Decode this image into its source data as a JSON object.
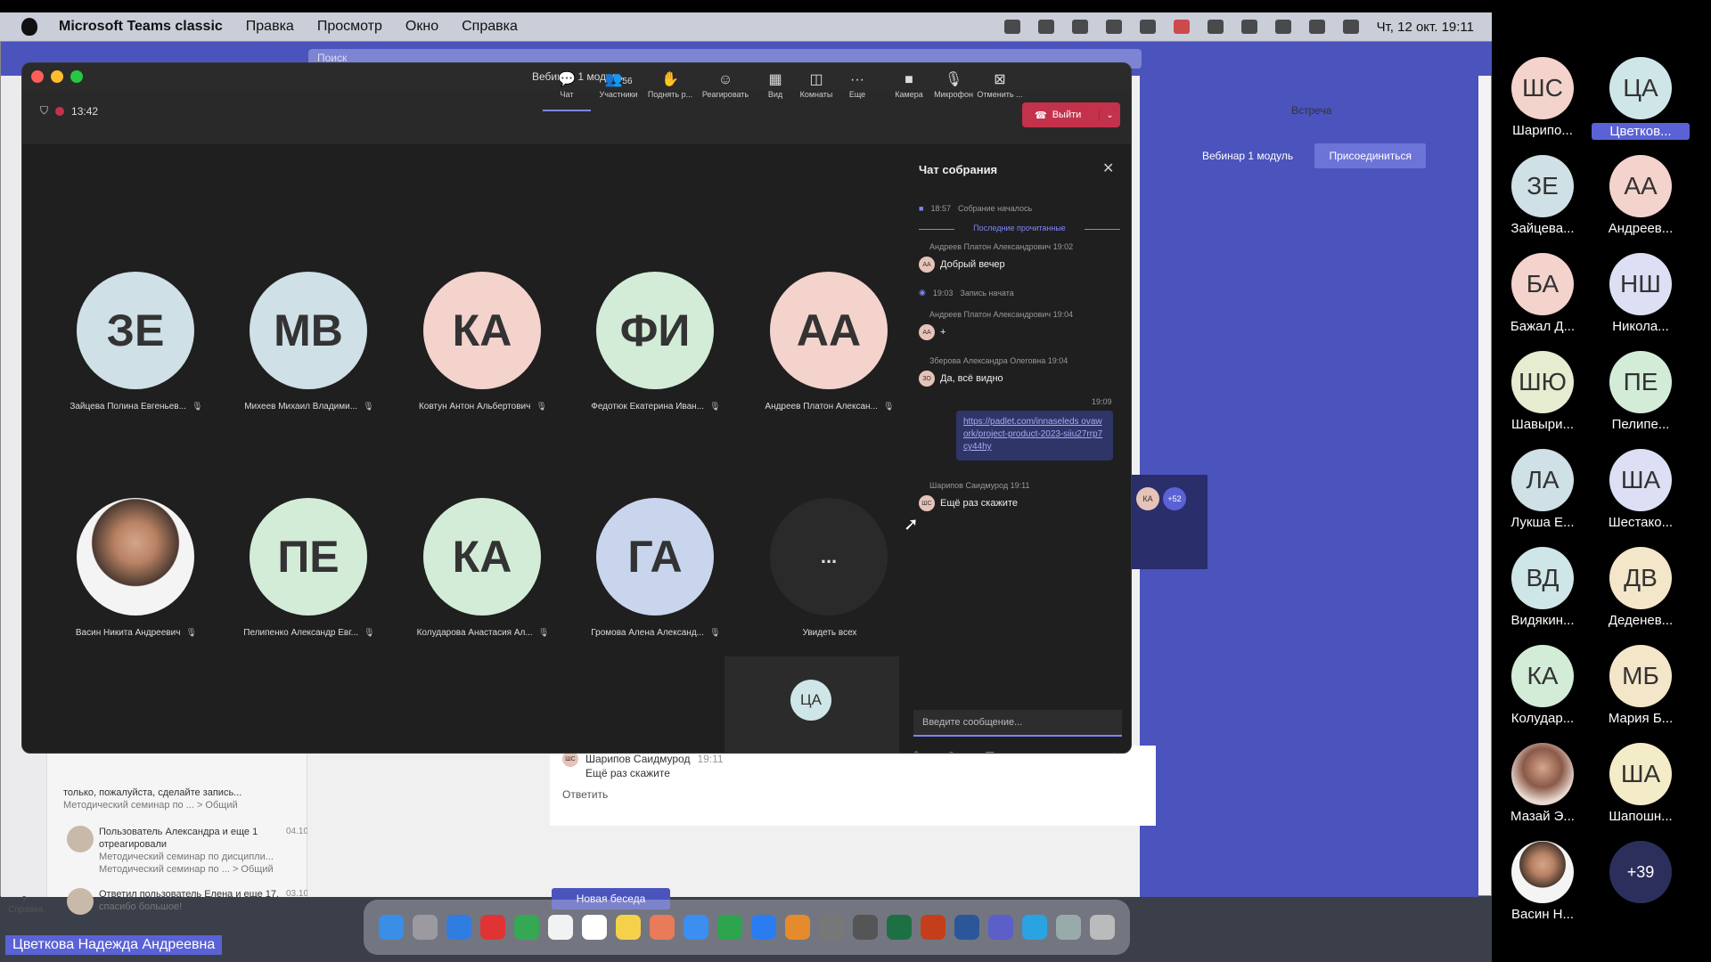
{
  "menubar": {
    "app": "Microsoft Teams classic",
    "items": [
      "Правка",
      "Просмотр",
      "Окно",
      "Справка"
    ],
    "datetime": "Чт, 12 окт. 19:11"
  },
  "bg": {
    "search": "Поиск",
    "vstrecha": "Встреча",
    "vebinar": "Вебинар 1 модуль",
    "join": "Присоединиться",
    "mini_av": [
      "КА",
      "+52"
    ],
    "list": [
      {
        "title": "только, пожалуйста, сделайте запись...",
        "sub": "Методический семинар по ... > Общий",
        "av": ""
      },
      {
        "title": "Пользователь Александра и еще 1 отреагировали",
        "sub": "Методический семинар по дисципли... Методический семинар по ... > Общий",
        "av": "",
        "date": "04.10"
      },
      {
        "title": "Ответил пользователь Елена и еще 17.",
        "sub": "спасибо большое!",
        "av": "",
        "date": "03.10"
      }
    ],
    "help": "Справка",
    "reply": {
      "sender": "Шарипов Саидмурод",
      "time": "19:11",
      "text": "Ещё раз скажите",
      "reply": "Ответить",
      "av": "ШС"
    },
    "new_chat": "Новая беседа"
  },
  "meeting": {
    "title": "Вебинар 1 модуль",
    "timer": "13:42",
    "toolbar": [
      {
        "icon": "chat-icon",
        "label": "Чат",
        "glyph": "💬",
        "count": ""
      },
      {
        "icon": "participants-icon",
        "label": "Участники",
        "glyph": "👥",
        "count": "56"
      },
      {
        "icon": "raise-hand-icon",
        "label": "Поднять р...",
        "glyph": "✋",
        "count": ""
      },
      {
        "icon": "react-icon",
        "label": "Реагировать",
        "glyph": "☺",
        "count": ""
      },
      {
        "icon": "view-icon",
        "label": "Вид",
        "glyph": "▦",
        "count": ""
      },
      {
        "icon": "rooms-icon",
        "label": "Комнаты",
        "glyph": "◫",
        "count": ""
      },
      {
        "icon": "more-icon",
        "label": "Еще",
        "glyph": "···",
        "count": ""
      },
      {
        "icon": "camera-icon",
        "label": "Камера",
        "glyph": "■",
        "count": ""
      },
      {
        "icon": "microphone-icon",
        "label": "Микрофон",
        "glyph": "🎙",
        "count": ""
      },
      {
        "icon": "share-icon",
        "label": "Отменить ...",
        "glyph": "⊠",
        "count": ""
      }
    ],
    "leave": "Выйти",
    "participants": [
      {
        "initials": "ЗЕ",
        "name": "Зайцева Полина Евгеньев...",
        "color": "#cfe0e6"
      },
      {
        "initials": "МВ",
        "name": "Михеев Михаил Владими...",
        "color": "#cfe0e6"
      },
      {
        "initials": "КА",
        "name": "Ковтун Антон Альбертович",
        "color": "#f4d3cd"
      },
      {
        "initials": "ФИ",
        "name": "Федотюк Екатерина Иван...",
        "color": "#d3ecd8"
      },
      {
        "initials": "АА",
        "name": "Андреев Платон Алексан...",
        "color": "#f4d3cd"
      },
      {
        "initials": "",
        "name": "Васин Никита Андреевич",
        "color": "photo"
      },
      {
        "initials": "ПЕ",
        "name": "Пелипенко Александр Евг...",
        "color": "#d3ecd8"
      },
      {
        "initials": "КА",
        "name": "Колударова Анастасия Ал...",
        "color": "#d3ecd8"
      },
      {
        "initials": "ГА",
        "name": "Громова Алена Александ...",
        "color": "#c8d5ec"
      },
      {
        "initials": "...",
        "name": "Увидеть всех",
        "color": "#2a2a2a"
      }
    ],
    "self_initials": "ЦА"
  },
  "chat": {
    "title": "Чат собрания",
    "events": [
      {
        "time": "18:57",
        "text": "Собрание началось"
      },
      {
        "time": "19:03",
        "text": "Запись начата"
      }
    ],
    "unread": "Последние прочитанные",
    "messages": [
      {
        "who": "Андреев Платон Александрович",
        "time": "19:02",
        "text": "Добрый вечер",
        "av": "АА"
      },
      {
        "who": "Андреев Платон Александрович",
        "time": "19:04",
        "text": "+",
        "av": "АА"
      },
      {
        "who": "Зберова Александра Олеговна",
        "time": "19:04",
        "text": "Да, всё видно",
        "av": "ЗО"
      },
      {
        "who": "Шарипов Саидмурод",
        "time": "19:11",
        "text": "Ещё раз скажите",
        "av": "ШС"
      }
    ],
    "link_time": "19:09",
    "link": "https://padlet.com/innaseleds ovawork/project-product-2023-siiu27rrp7cy44hy",
    "input_placeholder": "Введите сообщение..."
  },
  "gallery": [
    {
      "initials": "ШС",
      "name": "Шарипо...",
      "color": "#f4d3cd"
    },
    {
      "initials": "ЦА",
      "name": "Цветков...",
      "color": "#cfe6e8",
      "hl": true
    },
    {
      "initials": "ЗЕ",
      "name": "Зайцева...",
      "color": "#cfe0e6"
    },
    {
      "initials": "АА",
      "name": "Андреев...",
      "color": "#f4d3cd"
    },
    {
      "initials": "БА",
      "name": "Бажал Д...",
      "color": "#f4d3cd"
    },
    {
      "initials": "НШ",
      "name": "Никола...",
      "color": "#dde0f4"
    },
    {
      "initials": "ШЮ",
      "name": "Шавыри...",
      "color": "#e6ecd0"
    },
    {
      "initials": "ПЕ",
      "name": "Пелипе...",
      "color": "#d3ecd8"
    },
    {
      "initials": "ЛА",
      "name": "Лукша Е...",
      "color": "#cfe0e6"
    },
    {
      "initials": "ША",
      "name": "Шестако...",
      "color": "#dde0f4"
    },
    {
      "initials": "ВД",
      "name": "Видякин...",
      "color": "#cfe6e8"
    },
    {
      "initials": "ДВ",
      "name": "Деденев...",
      "color": "#f4e6c8"
    },
    {
      "initials": "КА",
      "name": "Колудар...",
      "color": "#d3ecd8"
    },
    {
      "initials": "МБ",
      "name": "Мария Б...",
      "color": "#f4e6c8"
    },
    {
      "initials": "",
      "name": "Мазай Э...",
      "color": "photo2"
    },
    {
      "initials": "ША",
      "name": "Шапошн...",
      "color": "#f4ecc8"
    },
    {
      "initials": "",
      "name": "Васин Н...",
      "color": "photo"
    },
    {
      "initials": "+39",
      "name": "",
      "color": "#2c2f5c"
    }
  ],
  "speaker": "Цветкова Надежда Андреевна"
}
